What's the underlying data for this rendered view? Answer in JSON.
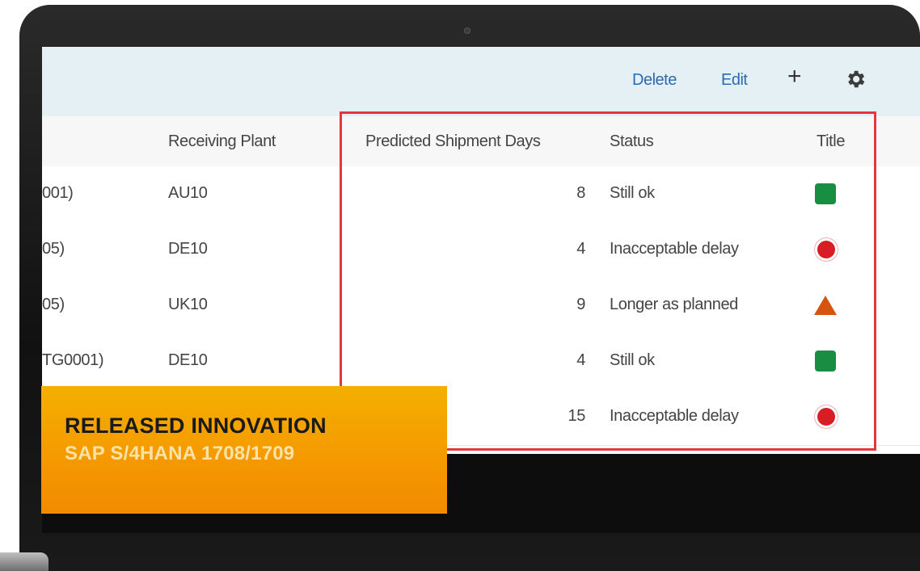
{
  "toolbar": {
    "delete_label": "Delete",
    "edit_label": "Edit",
    "add_icon": "plus-icon",
    "settings_icon": "gear-icon"
  },
  "table": {
    "columns": {
      "receiving_plant": "Receiving Plant",
      "predicted_days": "Predicted Shipment Days",
      "status": "Status",
      "title": "Title"
    },
    "rows": [
      {
        "partial": "001)",
        "plant": "AU10",
        "days": "8",
        "status": "Still ok",
        "indicator": "green-square"
      },
      {
        "partial": "05)",
        "plant": "DE10",
        "days": "4",
        "status": "Inacceptable delay",
        "indicator": "red-circle"
      },
      {
        "partial": "05)",
        "plant": "UK10",
        "days": "9",
        "status": "Longer as planned",
        "indicator": "orange-triangle"
      },
      {
        "partial": "TG0001)",
        "plant": "DE10",
        "days": "4",
        "status": "Still ok",
        "indicator": "green-square"
      },
      {
        "partial": "",
        "plant": "",
        "days": "15",
        "status": "Inacceptable delay",
        "indicator": "red-circle"
      }
    ]
  },
  "banner": {
    "line1": "RELEASED INNOVATION",
    "line2": "SAP S/4HANA 1708/1709"
  },
  "colors": {
    "link": "#2a6bb0",
    "highlight": "#e4363f",
    "green": "#188e42",
    "red": "#d81e24",
    "orange": "#d8530f",
    "banner": "#f5a000"
  }
}
